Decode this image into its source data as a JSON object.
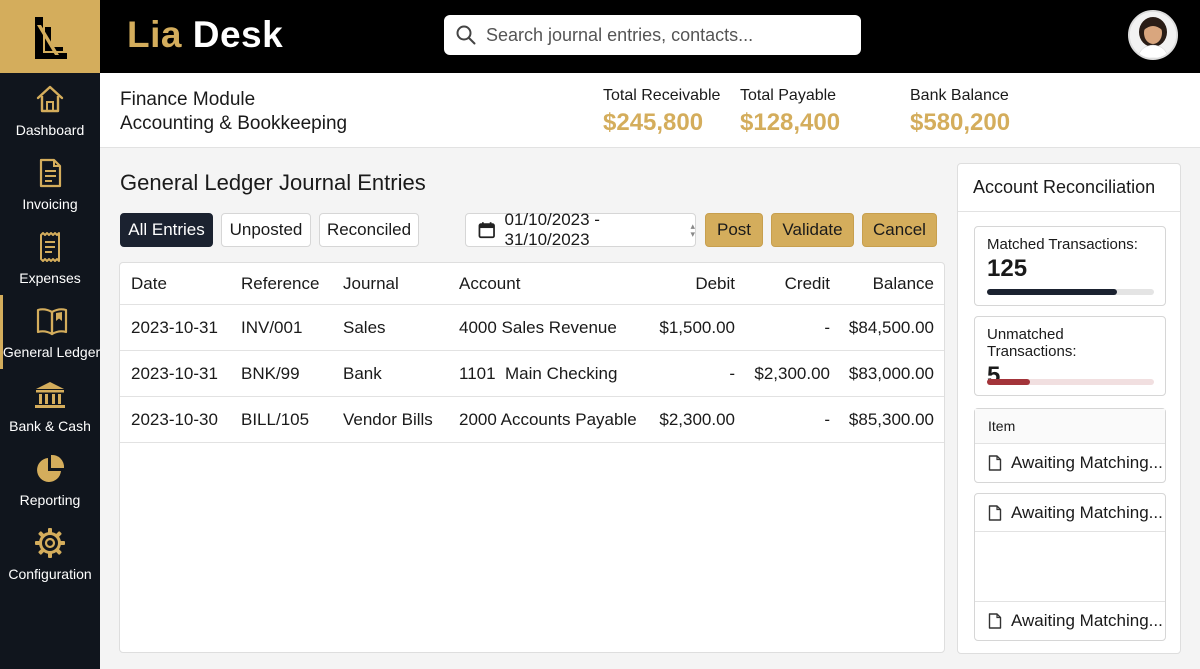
{
  "app": {
    "name_part1": "Lia",
    "name_part2": "Desk"
  },
  "search": {
    "placeholder": "Search journal entries, contacts..."
  },
  "sidebar": {
    "items": [
      {
        "label": "Dashboard",
        "icon": "home-icon"
      },
      {
        "label": "Invoicing",
        "icon": "document-icon"
      },
      {
        "label": "Expenses",
        "icon": "receipt-icon"
      },
      {
        "label": "General Ledger",
        "icon": "book-icon",
        "active": true
      },
      {
        "label": "Bank & Cash",
        "icon": "bank-icon"
      },
      {
        "label": "Reporting",
        "icon": "pie-chart-icon"
      },
      {
        "label": "Configuration",
        "icon": "gear-icon"
      }
    ]
  },
  "header": {
    "module_line1": "Finance Module",
    "module_line2": "Accounting & Bookkeeping",
    "kpis": [
      {
        "label": "Total Receivable",
        "value": "$245,800"
      },
      {
        "label": "Total Payable",
        "value": "$128,400"
      },
      {
        "label": "Bank Balance",
        "value": "$580,200"
      }
    ]
  },
  "main": {
    "title": "General Ledger Journal Entries",
    "filters": [
      "All Entries",
      "Unposted",
      "Reconciled"
    ],
    "active_filter": "All Entries",
    "date_range": "01/10/2023 - 31/10/2023",
    "actions": [
      "Post",
      "Validate",
      "Cancel"
    ],
    "table": {
      "columns": [
        "Date",
        "Reference",
        "Journal",
        "Account",
        "Debit",
        "Credit",
        "Balance"
      ],
      "rows": [
        [
          "2023-10-31",
          "INV/001",
          "Sales",
          "4000 Sales Revenue",
          "$1,500.00",
          "-",
          "$84,500.00"
        ],
        [
          "2023-10-31",
          "BNK/99",
          "Bank",
          "1101  Main Checking",
          "-",
          "$2,300.00",
          "$83,000.00"
        ],
        [
          "2023-10-30",
          "BILL/105",
          "Vendor Bills",
          "2000 Accounts Payable",
          "$2,300.00",
          "-",
          "$85,300.00"
        ]
      ]
    }
  },
  "reconciliation": {
    "title": "Account Reconciliation",
    "matched": {
      "label": "Matched Transactions:",
      "value": "125",
      "progress": 0.78,
      "color": "#1b2230",
      "track": "#e4e4e4"
    },
    "unmatched": {
      "label": "Unmatched Transactions:",
      "value": "5",
      "progress": 0.26,
      "color": "#a3343a",
      "track": "#f1dfe0"
    },
    "items_header": "Item",
    "items": [
      "Awaiting Matching...",
      "Awaiting Matching...",
      "Awaiting Matching..."
    ]
  },
  "colors": {
    "accent": "#d4ad5c",
    "sidebar": "#10151d",
    "dark_button": "#1b2230"
  }
}
